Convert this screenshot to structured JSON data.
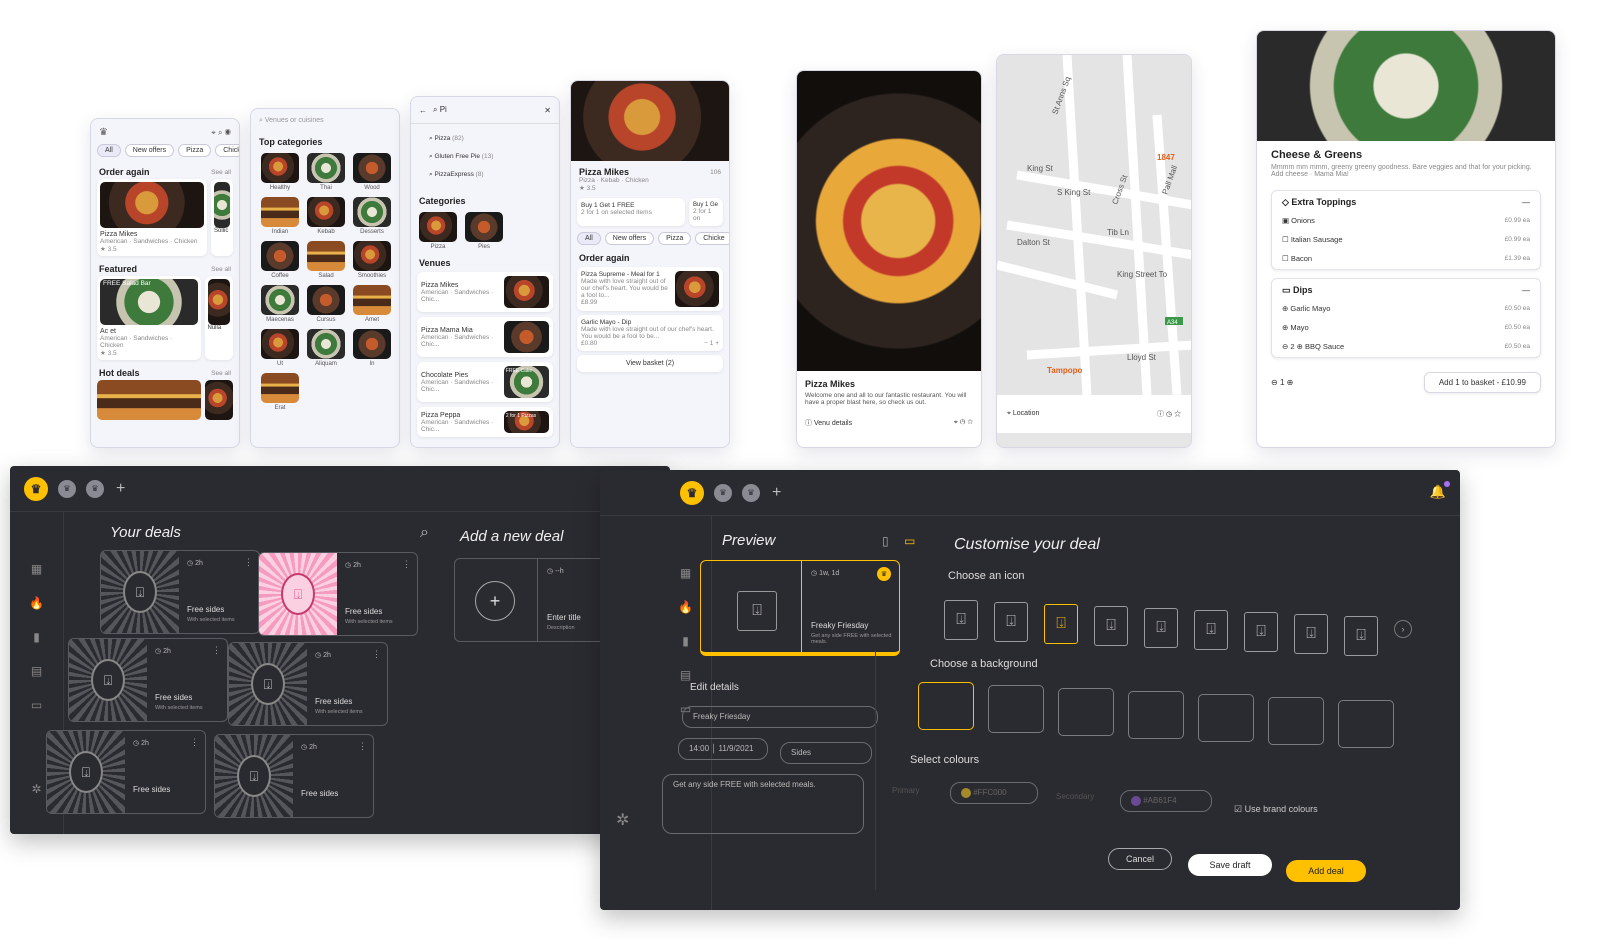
{
  "colors": {
    "accent": "#FFC000",
    "secondary": "#AB61F4",
    "dark": "#2A2A31"
  },
  "phone1": {
    "filters": [
      "All",
      "New offers",
      "Pizza",
      "Chicke"
    ],
    "order_again": "Order again",
    "see_all": "See all",
    "venue1": "Pizza Mikes",
    "venue1_tags": "American · Sandwiches · Chicken",
    "venue1_side": "Sollic",
    "featured": "Featured",
    "featured_item": "Ac et",
    "featured_tags": "American · Sandwiches · Chicken",
    "featured_badge": "FREE Salad Bar",
    "featured_side": "Nulla",
    "hot_deals": "Hot deals",
    "rating": "3.5"
  },
  "phone2": {
    "search_placeholder": "Venues or cuisines",
    "top_categories": "Top categories",
    "categories": [
      "Healthy",
      "Thai",
      "Wood",
      "Indian",
      "Kebab",
      "Desserts",
      "Coffee",
      "Salad",
      "Smoothies",
      "Maecenas",
      "Cursus",
      "Amet",
      "Ut",
      "Aliquam",
      "In",
      "Erat"
    ]
  },
  "phone3": {
    "query": "Pi",
    "suggestions": [
      {
        "label": "Pizza",
        "count": "(82)"
      },
      {
        "label": "Gluten Free Pie",
        "count": "(13)"
      },
      {
        "label": "PizzaExpress",
        "count": "(8)"
      }
    ],
    "categories_title": "Categories",
    "categories": [
      "Pizza",
      "Pies"
    ],
    "venues_title": "Venues",
    "venues": [
      {
        "name": "Pizza Mikes",
        "tags": "American · Sandwiches · Chic..."
      },
      {
        "name": "Pizza Mama Mia",
        "tags": "American · Sandwiches · Chic..."
      },
      {
        "name": "Chocolate Pies",
        "tags": "American · Sandwiches · Chic...",
        "badge": "FREE Cake"
      },
      {
        "name": "Pizza Peppa",
        "tags": "American · Sandwiches · Chic...",
        "badge": "2 for 1 Pizzas"
      }
    ]
  },
  "phone4": {
    "venue": "Pizza Mikes",
    "tags": "Pizza · Kebab · Chicken",
    "rating": "3.5",
    "count": "106",
    "deal1_title": "Buy 1 Get 1 FREE",
    "deal1_desc": "2 for 1 on selected items",
    "deal2_title": "Buy 1 Ge",
    "deal2_desc": "2 for 1 on",
    "filters": [
      "All",
      "New offers",
      "Pizza",
      "Chicke"
    ],
    "order_again": "Order again",
    "item1_title": "Pizza Supreme - Meal for 1",
    "item1_desc": "Made with love straight out of our chef's heart. You would be a fool to...",
    "item1_price": "£8.99",
    "item2_title": "Garlic Mayo - Dip",
    "item2_desc": "Made with love straight out of our chef's heart. You would be a fool to be...",
    "item2_price": "£0.80",
    "item2_qty": "1",
    "basket": "View basket (2)"
  },
  "phone5": {
    "venue": "Pizza Mikes",
    "desc": "Welcome one and all to our fantastic restaurant. You will have a proper blast here, so check us out.",
    "details": "Venu details"
  },
  "phone6": {
    "streets": [
      "St Anns Sq",
      "King St",
      "S King St",
      "Cross St",
      "Tib Ln",
      "Pall Mall",
      "Dalton St",
      "King Street To",
      "Lloyd St"
    ],
    "places": [
      "1847",
      "Tampopo"
    ],
    "road": "A34",
    "location": "Location"
  },
  "phone7": {
    "title": "Cheese & Greens",
    "desc": "Mmmm mm mmm, greeny greeny goodness. Bare veggies and that for your picking. Add cheese · Mama Mia!",
    "toppings_title": "Extra Toppings",
    "toppings": [
      {
        "name": "Onions",
        "price": "£0.99 ea"
      },
      {
        "name": "Italian Sausage",
        "price": "£0.99 ea"
      },
      {
        "name": "Bacon",
        "price": "£1.39 ea"
      }
    ],
    "dips_title": "Dips",
    "dips": [
      {
        "name": "Garlic Mayo",
        "price": "£0.50 ea"
      },
      {
        "name": "Mayo",
        "price": "£0.50 ea"
      },
      {
        "name": "BBQ Sauce",
        "price": "£0.50 ea",
        "qty": "2"
      }
    ],
    "qty": "1",
    "add_button": "Add 1 to basket - £10.99"
  },
  "dash_left": {
    "your_deals": "Your deals",
    "add_new_deal": "Add a new deal",
    "deals": [
      {
        "time": "2h",
        "name": "Free sides",
        "desc": "With selected items"
      },
      {
        "time": "2h",
        "name": "Free sides",
        "desc": "With selected items"
      },
      {
        "time": "2h",
        "name": "Free sides",
        "desc": "With selected items"
      },
      {
        "time": "2h",
        "name": "Free sides",
        "desc": "With selected items"
      },
      {
        "time": "2h",
        "name": "Free sides",
        "desc": ""
      },
      {
        "time": "2h",
        "name": "Free sides",
        "desc": ""
      }
    ],
    "new_time": "--h",
    "new_title": "Enter title",
    "new_desc": "Description"
  },
  "dash_right": {
    "preview": "Preview",
    "preview_time": "1w, 1d",
    "preview_name": "Freaky Friesday",
    "preview_desc": "Get any side FREE with selected meals.",
    "edit_details": "Edit details",
    "name_value": "Freaky Friesday",
    "time_value": "14:00",
    "date_value": "11/9/2021",
    "category_value": "Sides",
    "desc_value": "Get any side FREE with selected meals.",
    "customise": "Customise your deal",
    "choose_icon": "Choose an icon",
    "choose_bg": "Choose a background",
    "select_colours": "Select colours",
    "primary_label": "Primary",
    "primary_value": "#FFC000",
    "secondary_label": "Secondary",
    "secondary_value": "#AB61F4",
    "use_brand": "Use brand colours",
    "cancel": "Cancel",
    "save_draft": "Save draft",
    "add_deal": "Add deal"
  }
}
